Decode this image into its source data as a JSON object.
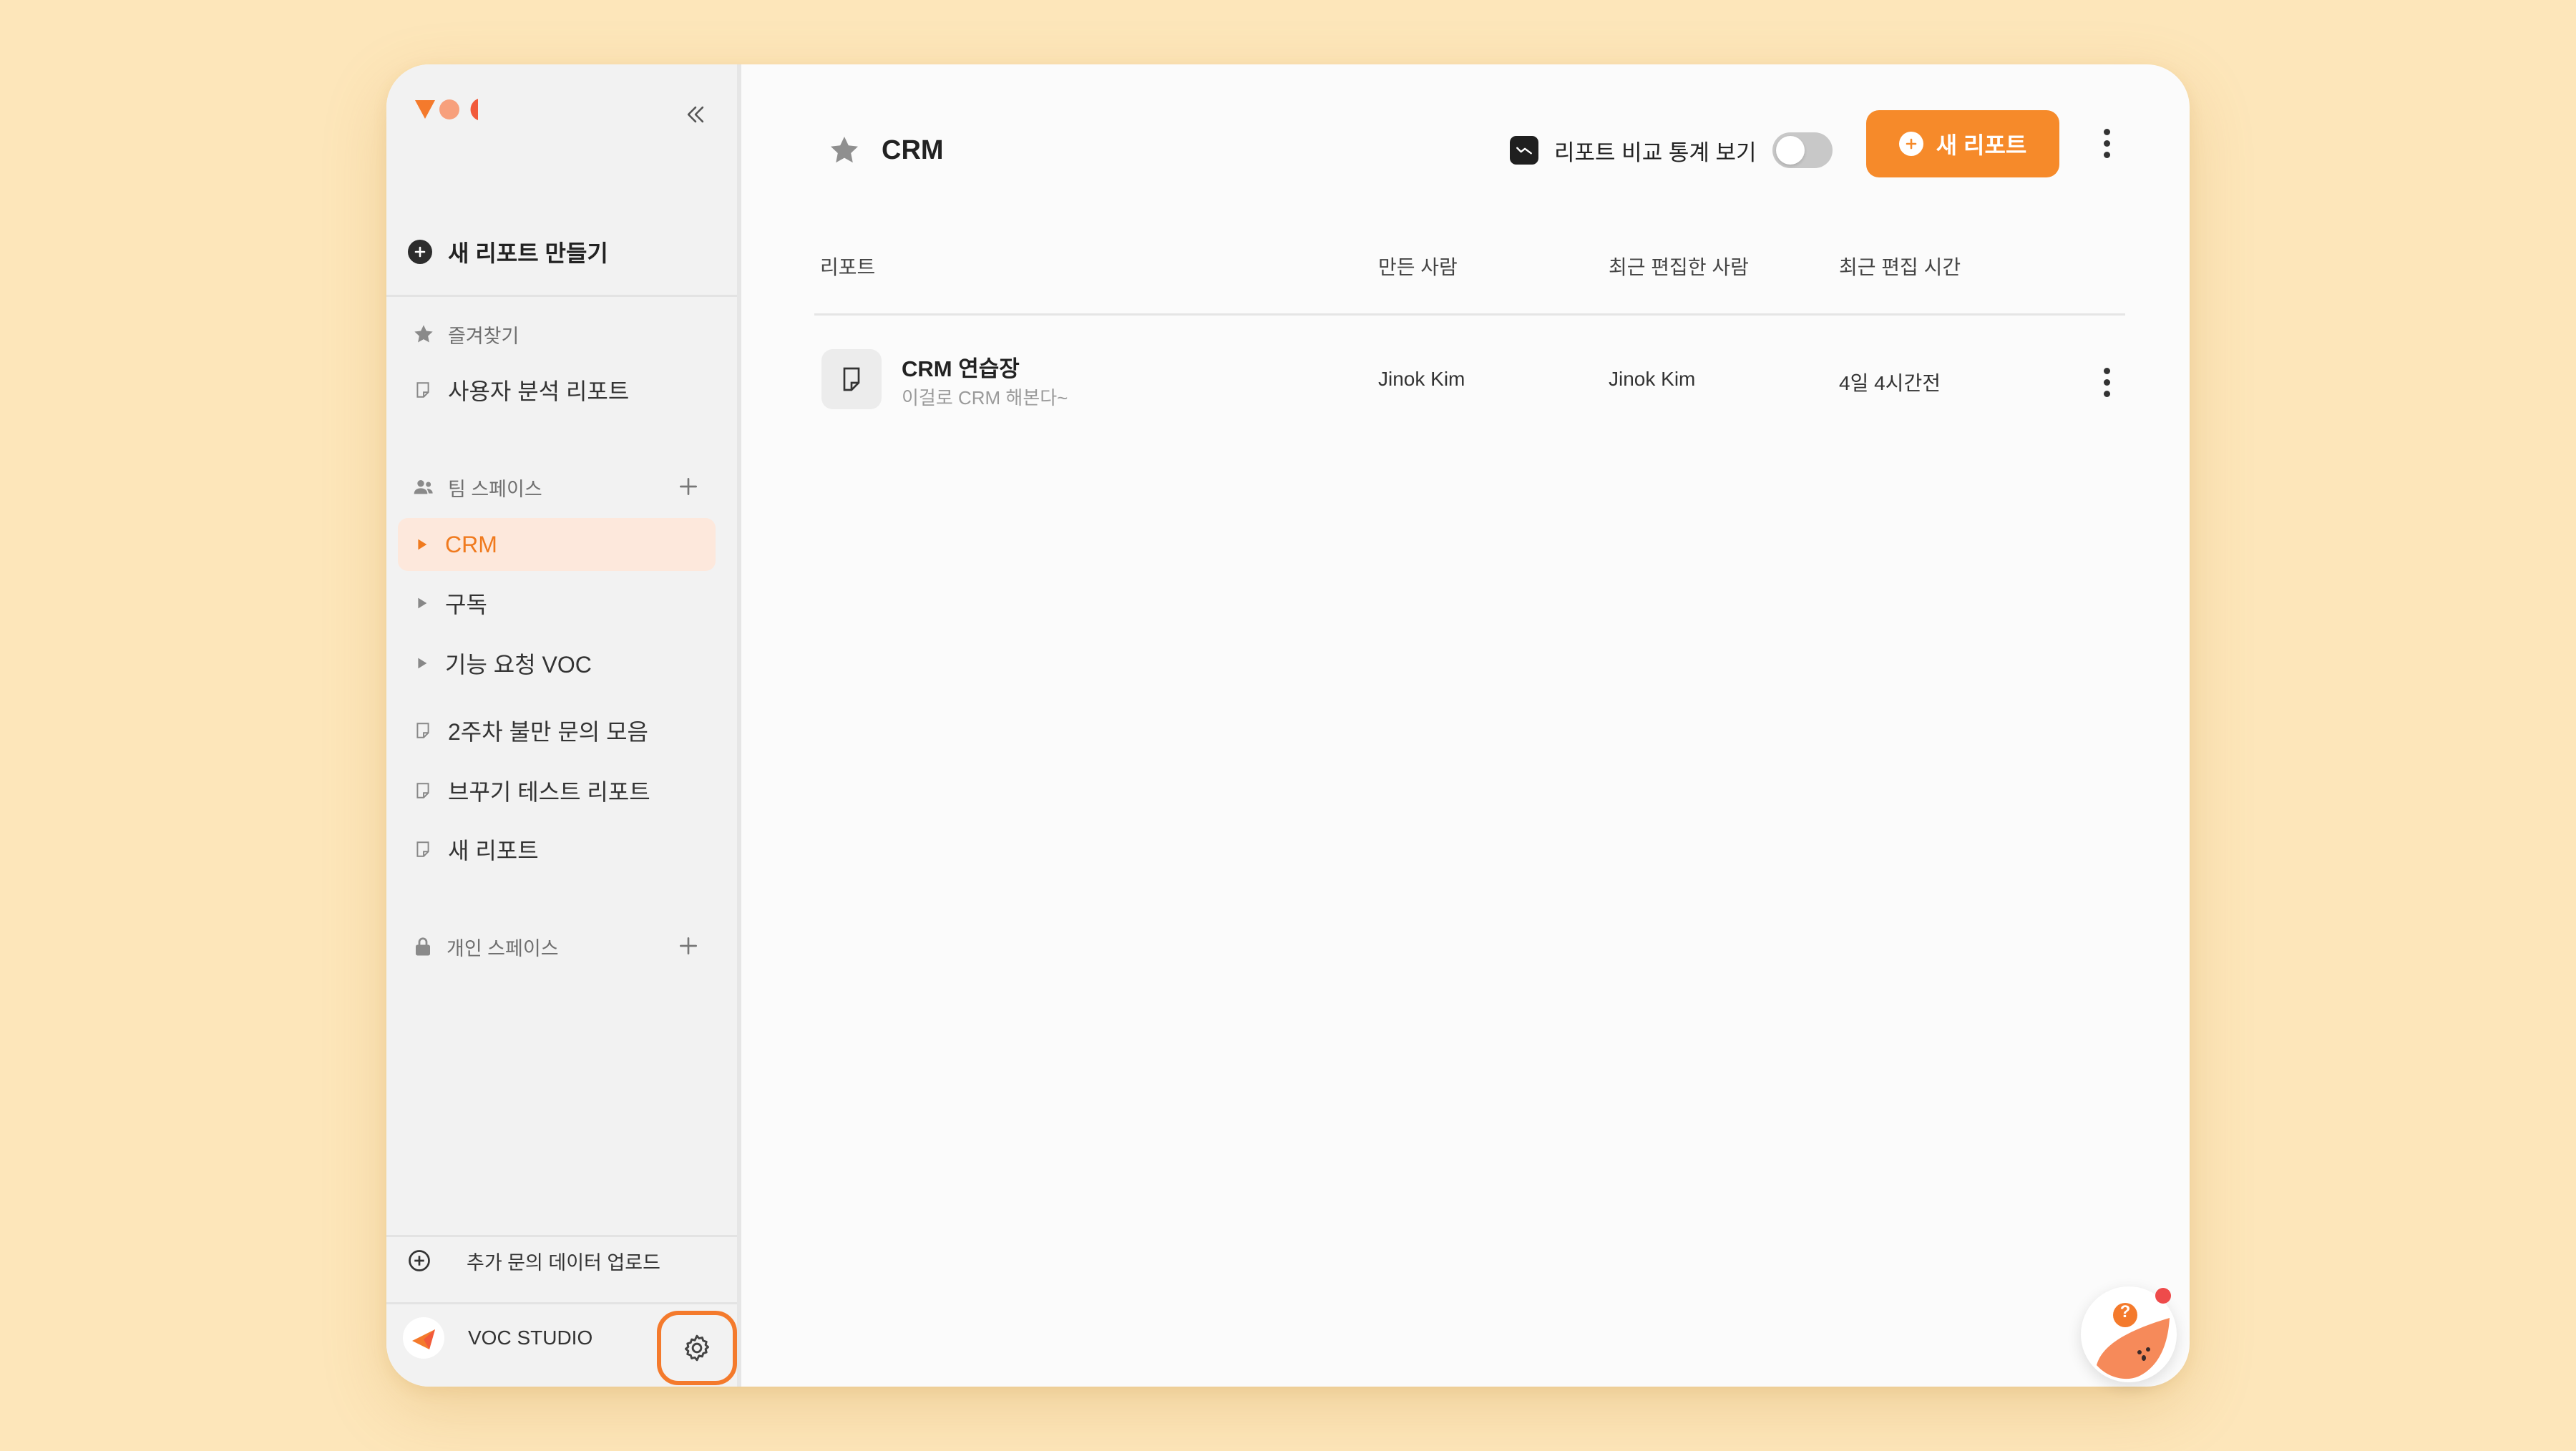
{
  "sidebar": {
    "new_report_label": "새 리포트 만들기",
    "favorites_label": "즐겨찾기",
    "favorite_items": [
      "사용자 분석 리포트"
    ],
    "team_space_label": "팀 스페이스",
    "team_items": [
      {
        "label": "CRM",
        "type": "folder",
        "active": true
      },
      {
        "label": "구독",
        "type": "folder",
        "active": false
      },
      {
        "label": "기능 요청 VOC",
        "type": "folder",
        "active": false
      },
      {
        "label": "2주차 불만 문의 모음",
        "type": "report",
        "active": false
      },
      {
        "label": "브꾸기 테스트 리포트",
        "type": "report",
        "active": false
      },
      {
        "label": "새 리포트",
        "type": "report",
        "active": false
      }
    ],
    "personal_space_label": "개인 스페이스",
    "upload_label": "추가 문의 데이터 업로드",
    "user_name": "VOC STUDIO"
  },
  "header": {
    "title": "CRM",
    "compare_label": "리포트 비교 통계 보기",
    "compare_enabled": false,
    "new_report_button": "새 리포트"
  },
  "table": {
    "columns": [
      "리포트",
      "만든 사람",
      "최근 편집한 사람",
      "최근 편집 시간"
    ],
    "rows": [
      {
        "title": "CRM 연습장",
        "subtitle": "이걸로 CRM 해본다~",
        "creator": "Jinok Kim",
        "last_editor": "Jinok Kim",
        "edited": "4일 4시간전"
      }
    ]
  },
  "help": {
    "badge": "?"
  },
  "colors": {
    "accent": "#f68a2a",
    "active_bg": "#fde8dc",
    "active_text": "#f07a1e",
    "background": "#fde6ba"
  }
}
